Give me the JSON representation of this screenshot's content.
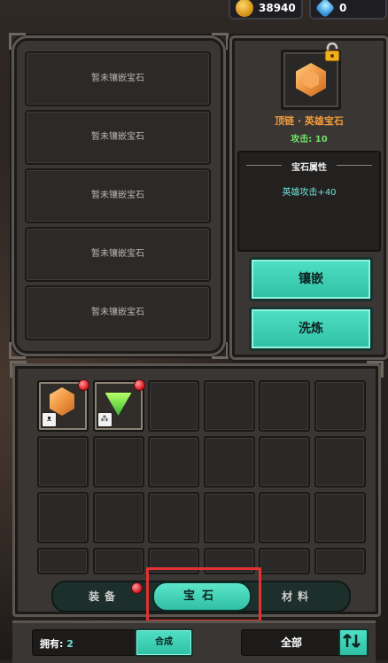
{
  "currency": {
    "gold": "38940",
    "gold_icon": "crown-coin-icon",
    "gems": "0",
    "gem_icon": "diamond-icon"
  },
  "sockets": [
    {
      "label": "暂未镶嵌宝石"
    },
    {
      "label": "暂未镶嵌宝石"
    },
    {
      "label": "暂未镶嵌宝石"
    },
    {
      "label": "暂未镶嵌宝石"
    },
    {
      "label": "暂未镶嵌宝石"
    }
  ],
  "detail": {
    "gem_name": "顶链 · 英雄宝石",
    "stat": "攻击: 10",
    "attr_title": "宝石属性",
    "attr_value": "英雄攻击+40",
    "btn_inlay": "镶嵌",
    "btn_refine": "洗炼",
    "colors": {
      "name": "#f09a3a",
      "stat": "#6fe06a",
      "attr": "#6fe2d8"
    }
  },
  "inventory": {
    "items": [
      {
        "icon": "orange-hex-gem-icon",
        "badge": "ᴥ",
        "new": true
      },
      {
        "icon": "green-triangle-gem-icon",
        "badge": "⁂",
        "new": true
      }
    ]
  },
  "tabs": {
    "equip": "装备",
    "gem": "宝石",
    "material": "材料",
    "active": "宝石"
  },
  "bottom": {
    "own_label": "拥有:",
    "own_value": "2",
    "merge_btn": "合成",
    "filter": "全部"
  }
}
